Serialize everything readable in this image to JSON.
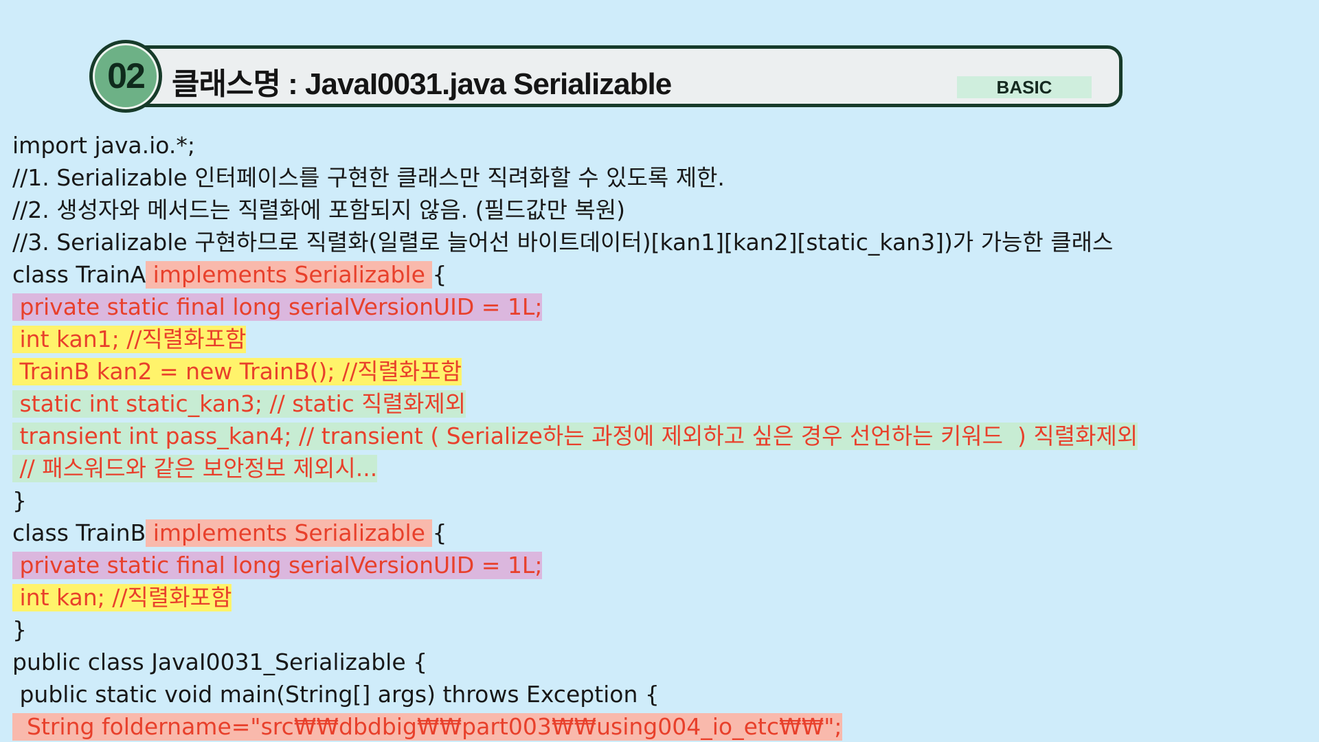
{
  "header": {
    "number": "02",
    "title": "클래스명 : JavaI0031.java  Serializable",
    "level": "BASIC"
  },
  "code": {
    "line1": "import java.io.*;",
    "line2": "//1. Serializable 인터페이스를 구현한 클래스만 직려화할 수 있도록 제한.",
    "line3": "//2. 생성자와 메서드는 직렬화에 포함되지 않음. (필드값만 복원)",
    "line4": "//3. Serializable 구현하므로 직렬화(일렬로 늘어선 바이트데이터)[kan1][kan2][static_kan3])가 가능한 클래스",
    "line5_a": "class TrainA",
    "line5_b": " implements Serializable ",
    "line5_c": "{",
    "line6": " private static final long serialVersionUID = 1L;",
    "line7": " int kan1; //직렬화포함",
    "line8": " TrainB kan2 = new TrainB(); //직렬화포함",
    "line9": " static int static_kan3; // static 직렬화제외",
    "line10": " transient int pass_kan4; // transient ( Serialize하는 과정에 제외하고 싶은 경우 선언하는 키워드  ) 직렬화제외",
    "line11": " // 패스워드와 같은 보안정보 제외시...",
    "line12": "}",
    "line13_a": "class TrainB",
    "line13_b": " implements Serializable ",
    "line13_c": "{",
    "line14": " private static final long serialVersionUID = 1L;",
    "line15": " int kan; //직렬화포함",
    "line16": "}",
    "line17": "public class JavaI0031_Serializable {",
    "line18": " public static void main(String[] args) throws Exception {",
    "line19": "  String foldername=\"src₩₩dbdbig₩₩part003₩₩using004_io_etc₩₩\";"
  },
  "colors": {
    "background": "#cfecfa",
    "header_border": "#173b2a",
    "badge_fill": "#6db186",
    "highlight_text": "#e8402b",
    "highlight_pink": "#f9b9ac",
    "highlight_purple": "#dbb7de",
    "highlight_yellow": "#fff36b",
    "highlight_green": "#c7ecd3",
    "level_tag_bg": "#cfeedd"
  }
}
